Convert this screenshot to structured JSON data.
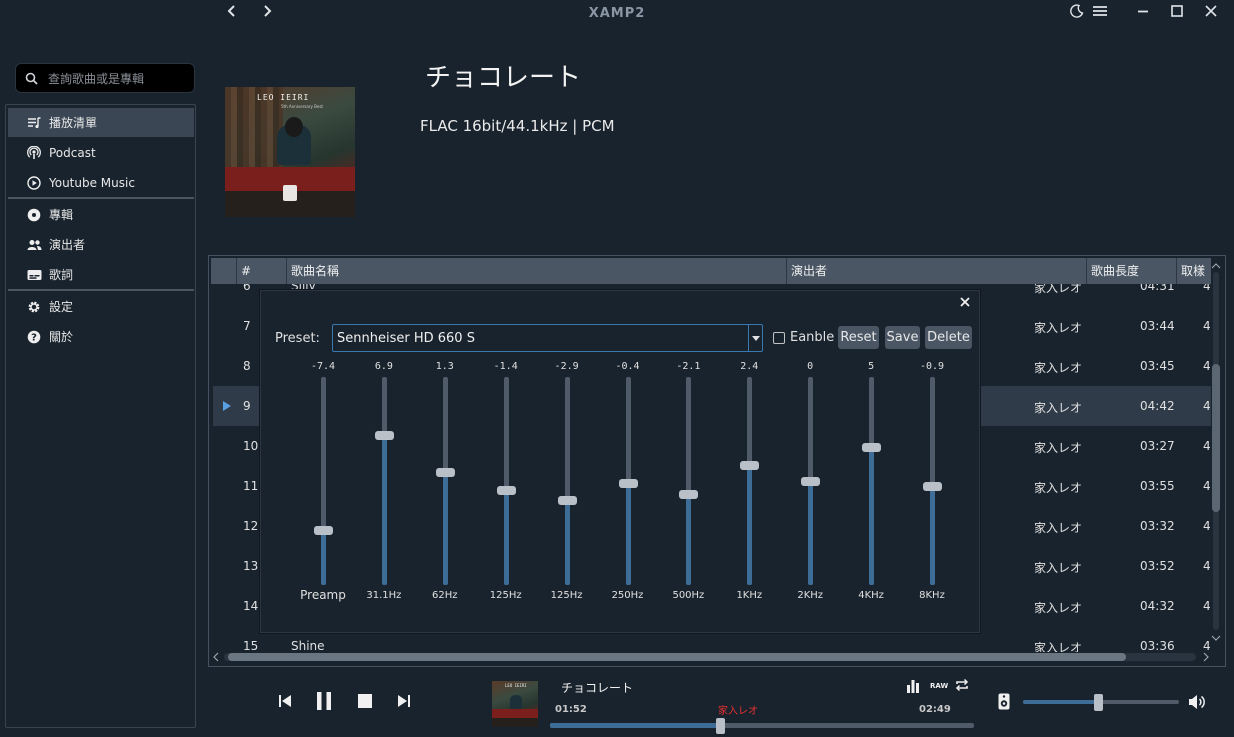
{
  "app": {
    "title": "XAMP2"
  },
  "search": {
    "placeholder": "查詢歌曲或是專輯"
  },
  "sidebar": {
    "items": [
      {
        "label": "播放清單",
        "icon": "playlist-icon"
      },
      {
        "label": "Podcast",
        "icon": "podcast-icon"
      },
      {
        "label": "Youtube Music",
        "icon": "play-circle-icon"
      },
      {
        "label": "專輯",
        "icon": "disc-icon"
      },
      {
        "label": "演出者",
        "icon": "people-icon"
      },
      {
        "label": "歌詞",
        "icon": "subtitles-icon"
      },
      {
        "label": "設定",
        "icon": "gear-icon"
      },
      {
        "label": "關於",
        "icon": "help-icon"
      }
    ]
  },
  "album": {
    "title": "チョコレート",
    "format": "FLAC 16bit/44.1kHz | PCM",
    "cover_text": "LEO IEIRI",
    "cover_subtext": "5th Anniversary Best"
  },
  "table": {
    "headers": [
      "#",
      "歌曲名稱",
      "演出者",
      "歌曲長度",
      "取樣"
    ],
    "rows": [
      {
        "num": "6",
        "title": "Silly",
        "artist": "家入レオ",
        "duration": "04:31",
        "extra": "4"
      },
      {
        "num": "7",
        "title": "",
        "artist": "家入レオ",
        "duration": "03:44",
        "extra": "4"
      },
      {
        "num": "8",
        "title": "",
        "artist": "家入レオ",
        "duration": "03:45",
        "extra": "4"
      },
      {
        "num": "9",
        "title": "",
        "artist": "家入レオ",
        "duration": "04:42",
        "extra": "4"
      },
      {
        "num": "10",
        "title": "",
        "artist": "家入レオ",
        "duration": "03:27",
        "extra": "4"
      },
      {
        "num": "11",
        "title": "",
        "artist": "家入レオ",
        "duration": "03:55",
        "extra": "4"
      },
      {
        "num": "12",
        "title": "",
        "artist": "家入レオ",
        "duration": "03:32",
        "extra": "4"
      },
      {
        "num": "13",
        "title": "",
        "artist": "家入レオ",
        "duration": "03:52",
        "extra": "4"
      },
      {
        "num": "14",
        "title": "",
        "artist": "家入レオ",
        "duration": "04:32",
        "extra": "4"
      },
      {
        "num": "15",
        "title": "Shine",
        "artist": "家入レオ",
        "duration": "03:36",
        "extra": "4"
      }
    ],
    "playing_row": "9"
  },
  "equalizer": {
    "preset_label": "Preset:",
    "preset_value": "Sennheiser HD 660 S",
    "enable_label": "Eanble",
    "enabled": false,
    "reset_label": "Reset",
    "save_label": "Save",
    "delete_label": "Delete",
    "gain_range": [
      -15,
      15
    ],
    "bands": [
      {
        "label": "Preamp",
        "gain": "-7.4"
      },
      {
        "label": "31.1Hz",
        "gain": "6.9"
      },
      {
        "label": "62Hz",
        "gain": "1.3"
      },
      {
        "label": "125Hz",
        "gain": "-1.4"
      },
      {
        "label": "125Hz",
        "gain": "-2.9"
      },
      {
        "label": "250Hz",
        "gain": "-0.4"
      },
      {
        "label": "500Hz",
        "gain": "-2.1"
      },
      {
        "label": "1KHz",
        "gain": "2.4"
      },
      {
        "label": "2KHz",
        "gain": "0"
      },
      {
        "label": "4KHz",
        "gain": "5"
      },
      {
        "label": "8KHz",
        "gain": "-0.9"
      }
    ]
  },
  "player": {
    "title": "チョコレート",
    "artist": "家入レオ",
    "elapsed": "01:52",
    "total": "02:49",
    "progress": 0.4,
    "volume": 0.48,
    "raw_label": "RAW",
    "accent_color": "#3d6d97",
    "artist_color": "#e83030"
  }
}
